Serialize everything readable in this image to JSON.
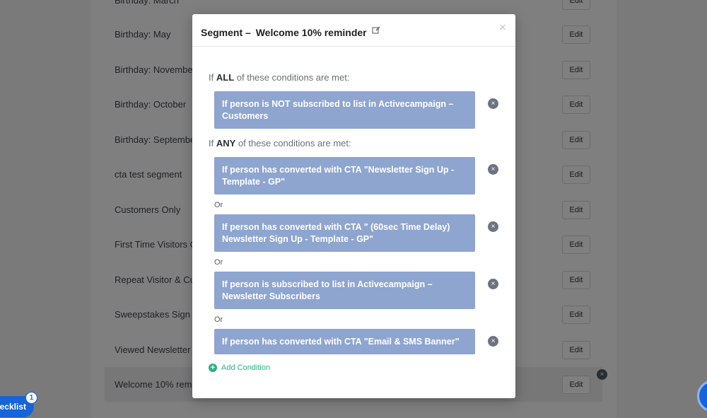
{
  "segments": {
    "rows": [
      {
        "name": "Birthday: March",
        "edit": "Edit"
      },
      {
        "name": "Birthday: May",
        "edit": "Edit"
      },
      {
        "name": "Birthday: November",
        "edit": "Edit"
      },
      {
        "name": "Birthday: October",
        "edit": "Edit"
      },
      {
        "name": "Birthday: September",
        "edit": "Edit"
      },
      {
        "name": "cta test segment",
        "edit": "Edit"
      },
      {
        "name": "Customers Only",
        "edit": "Edit"
      },
      {
        "name": "First Time Visitors O",
        "edit": "Edit"
      },
      {
        "name": "Repeat Visitor & Cu",
        "edit": "Edit"
      },
      {
        "name": "Sweepstakes Sign U",
        "edit": "Edit"
      },
      {
        "name": "Viewed Newsletter",
        "edit": "Edit"
      },
      {
        "name": "Welcome 10% remin",
        "edit": "Edit"
      }
    ],
    "remove_glyph": "×"
  },
  "checklist": {
    "label": "Checklist",
    "badge": "1"
  },
  "modal": {
    "title_prefix": "Segment –",
    "title_name": "Welcome 10% reminder",
    "close_glyph": "×",
    "all_heading": {
      "pre": "If",
      "keyword": "ALL",
      "post": "of these conditions are met:"
    },
    "any_heading": {
      "pre": "If",
      "keyword": "ANY",
      "post": "of these conditions are met:"
    },
    "all_conditions": [
      "If person is NOT subscribed to list in Activecampaign – Customers"
    ],
    "any_conditions": [
      "If person has converted with CTA \"Newsletter Sign Up - Template - GP\"",
      "If person has converted with CTA \" (60sec Time Delay) Newsletter Sign Up - Template - GP\"",
      "If person is subscribed to list in Activecampaign – Newsletter Subscribers",
      "If person has converted with CTA \"Email & SMS Banner\""
    ],
    "or_label": "Or",
    "remove_glyph": "×",
    "add_condition_label": "Add Condition",
    "add_glyph": "+"
  },
  "colors": {
    "condition_bg": "#8ea5cf",
    "accent_green": "#2ab27b",
    "checklist_blue": "#1764d8"
  }
}
